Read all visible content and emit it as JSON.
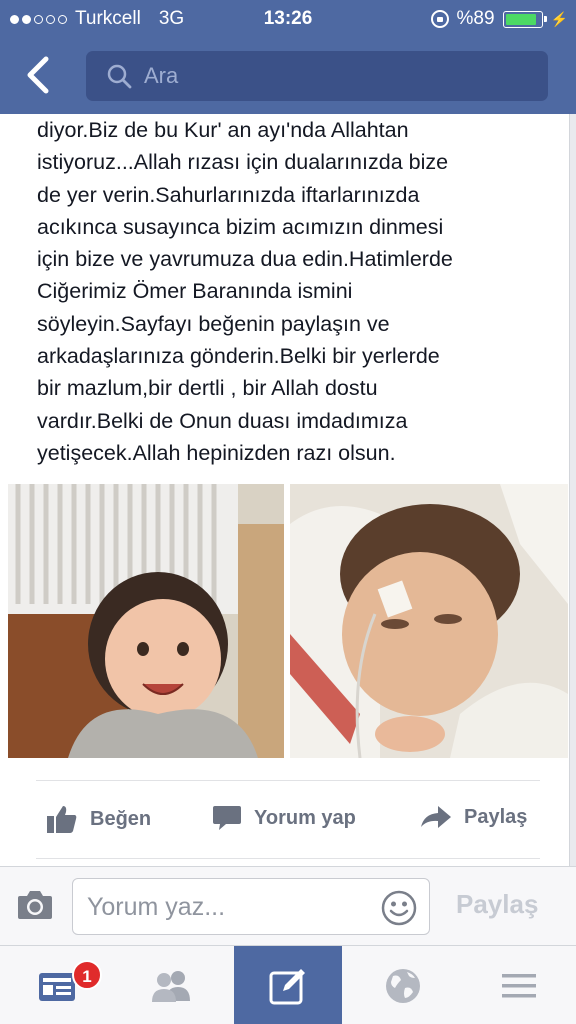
{
  "status_bar": {
    "carrier": "Turkcell",
    "network": "3G",
    "time": "13:26",
    "battery_percent": "%89",
    "battery_level": 0.89,
    "signal_bars_filled": 2,
    "signal_bars_total": 5
  },
  "nav": {
    "back_icon": "chevron-left-icon",
    "search_placeholder": "Ara"
  },
  "post": {
    "text": "diyor.Biz de bu Kur' an ayı'nda Allahtan\nistiyoruz...Allah rızası için dualarınızda bize\nde yer verin.Sahurlarınızda iftarlarınızda\nacıkınca susayınca bizim acımızın dinmesi\niçin bize ve yavrumuza dua edin.Hatimlerde\nCiğerimiz Ömer Baranında ismini\nsöyleyin.Sayfayı beğenin paylaşın ve\narkadaşlarınıza gönderin.Belki bir yerlerde\nbir mazlum,bir dertli , bir Allah dostu\nvardır.Belki de Onun duası imdadımıza\nyetişecek.Allah hepinizden razı olsun."
  },
  "actions": {
    "like_label": "Beğen",
    "comment_label": "Yorum yap",
    "share_label": "Paylaş"
  },
  "comment_bar": {
    "placeholder": "Yorum yaz...",
    "post_label": "Paylaş"
  },
  "tabbar": {
    "news_feed_badge": "1",
    "tabs": [
      "news-feed-icon",
      "friends-icon",
      "compose-icon",
      "globe-icon",
      "menu-icon"
    ],
    "active_index": 2
  },
  "colors": {
    "brand_blue": "#4e69a2",
    "search_bg": "#3b5188",
    "battery_green": "#4cd964",
    "badge_red": "#e02b2b"
  }
}
